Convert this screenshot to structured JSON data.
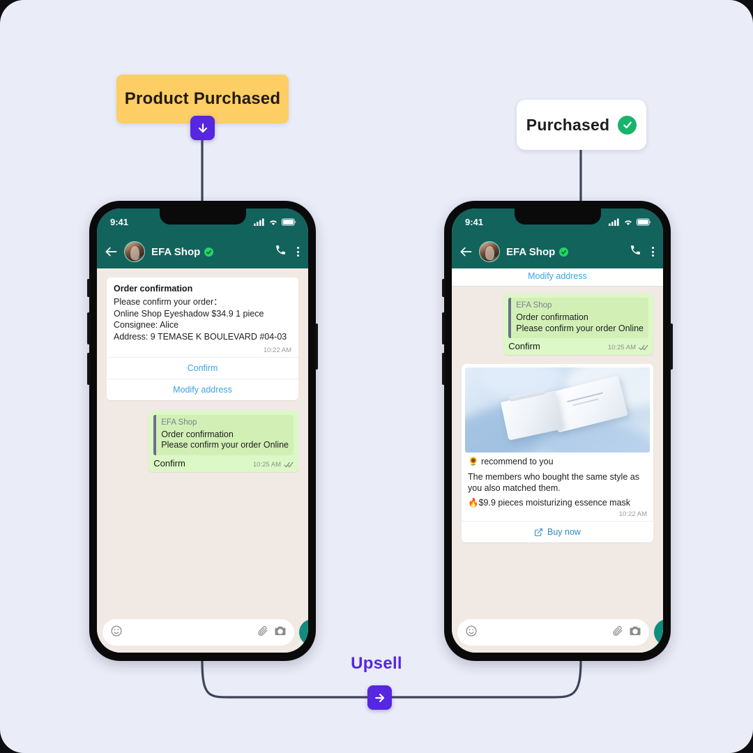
{
  "theme": {
    "canvas_bg": "#eaecf7",
    "accent_purple": "#5626e0",
    "badge_yellow": "#fcce64",
    "whatsapp_teal": "#11635c",
    "bubble_green": "#dcf8c6",
    "chat_bg": "#f1e9e4",
    "link_blue": "#3aa3e3",
    "verified_green": "#25d366"
  },
  "flow": {
    "trigger_badge": "Product Purchased",
    "result_badge": "Purchased",
    "connector_label": "Upsell",
    "trigger_icon": "arrow-down-icon",
    "result_icon": "check-circle-icon",
    "connector_icon": "arrow-right-icon"
  },
  "phone_left": {
    "status": {
      "time": "9:41",
      "signal_icon": "cellular-signal-icon",
      "wifi_icon": "wifi-icon",
      "battery_icon": "battery-full-icon"
    },
    "header": {
      "back_icon": "back-arrow-icon",
      "avatar": "contact-avatar",
      "name": "EFA Shop",
      "verified_icon": "verified-badge-icon",
      "call_icon": "phone-call-icon",
      "menu_icon": "overflow-menu-icon"
    },
    "order_card": {
      "title": "Order confirmation",
      "line1": "Please confirm your order：",
      "line2": "Online Shop Eyeshadow $34.9  1 piece",
      "line3": "Consignee: Alice",
      "line4": "Address: 9 TEMASE K BOULEVARD #04-03",
      "time": "10:22 AM",
      "button_confirm": "Confirm",
      "button_modify": "Modify address"
    },
    "reply_bubble": {
      "quote_name": "EFA Shop",
      "quote_line1": "Order confirmation",
      "quote_line2": "Please confirm your order Online",
      "message": "Confirm",
      "time": "10:25 AM",
      "status_icon": "double-check-icon"
    },
    "composer": {
      "emoji_icon": "emoji-smiley-icon",
      "attach_icon": "paperclip-icon",
      "camera_icon": "camera-icon",
      "mic_icon": "microphone-icon",
      "placeholder": ""
    }
  },
  "phone_right": {
    "status": {
      "time": "9:41",
      "signal_icon": "cellular-signal-icon",
      "wifi_icon": "wifi-icon",
      "battery_icon": "battery-full-icon"
    },
    "header": {
      "back_icon": "back-arrow-icon",
      "avatar": "contact-avatar",
      "name": "EFA Shop",
      "verified_icon": "verified-badge-icon",
      "call_icon": "phone-call-icon",
      "menu_icon": "overflow-menu-icon"
    },
    "scrolled_button": "Modify address",
    "reply_bubble": {
      "quote_name": "EFA Shop",
      "quote_line1": "Order confirmation",
      "quote_line2": "Please confirm your order Online",
      "message": "Confirm",
      "time": "10:25 AM",
      "status_icon": "double-check-icon"
    },
    "product_card": {
      "image_alt": "white-cosmetic-packaging-on-blue-silk",
      "line1": "🌻 recommend to you",
      "line2": "The members who bought the same style as you also matched them.",
      "line3": "🔥$9.9 pieces moisturizing essence mask",
      "time": "10:22 AM",
      "cta_label": "Buy now",
      "cta_icon": "external-link-icon"
    },
    "composer": {
      "emoji_icon": "emoji-smiley-icon",
      "attach_icon": "paperclip-icon",
      "camera_icon": "camera-icon",
      "mic_icon": "microphone-icon",
      "placeholder": ""
    }
  }
}
